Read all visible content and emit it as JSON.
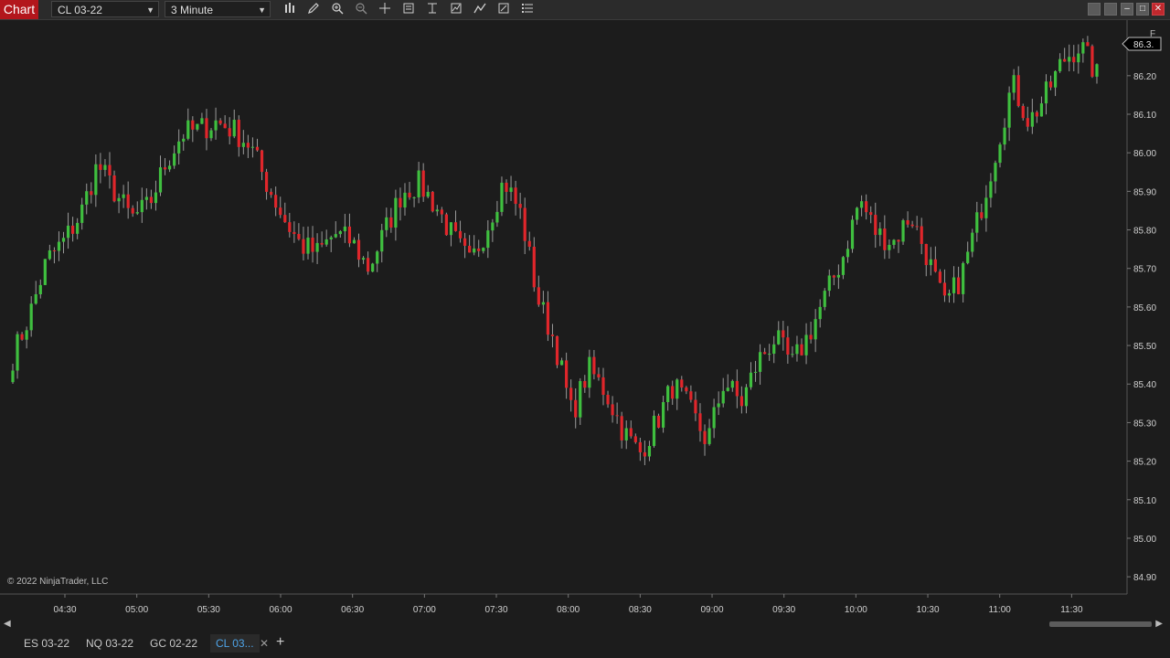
{
  "toolbar": {
    "chart_label": "Chart",
    "instrument": "CL 03-22",
    "interval": "3 Minute",
    "corner_label": "F"
  },
  "footer": {
    "copyright": "© 2022 NinjaTrader, LLC"
  },
  "tabs": [
    {
      "label": "ES 03-22"
    },
    {
      "label": "NQ 03-22"
    },
    {
      "label": "GC 02-22"
    },
    {
      "label": "CL 03..."
    }
  ],
  "colors": {
    "up": "#3fbf3f",
    "down": "#e0262b",
    "background": "#1c1c1c",
    "accent": "#b3161c"
  },
  "chart_data": {
    "type": "candlestick",
    "x_tick_labels": [
      "04:30",
      "05:00",
      "05:30",
      "06:00",
      "06:30",
      "07:00",
      "07:30",
      "08:00",
      "08:30",
      "09:00",
      "09:30",
      "10:00",
      "10:30",
      "11:00",
      "11:30"
    ],
    "y_tick_labels": [
      "86.20",
      "86.10",
      "86.00",
      "85.90",
      "85.80",
      "85.70",
      "85.60",
      "85.50",
      "85.40",
      "85.30",
      "85.20",
      "85.10",
      "85.00",
      "84.90"
    ],
    "y_tick_values": [
      86.2,
      86.1,
      86.0,
      85.9,
      85.8,
      85.7,
      85.6,
      85.5,
      85.4,
      85.3,
      85.2,
      85.1,
      85.0,
      84.9
    ],
    "ylim": [
      84.86,
      86.33
    ],
    "current_price_label": "86.3.",
    "close_path": [
      85.47,
      85.58,
      85.72,
      85.77,
      85.84,
      85.97,
      85.9,
      85.83,
      85.86,
      85.97,
      86.05,
      86.06,
      86.08,
      86.06,
      86.02,
      85.92,
      85.83,
      85.76,
      85.74,
      85.79,
      85.77,
      85.7,
      85.8,
      85.9,
      85.92,
      85.86,
      85.78,
      85.71,
      85.81,
      85.93,
      85.84,
      85.62,
      85.51,
      85.32,
      85.44,
      85.38,
      85.28,
      85.22,
      85.3,
      85.4,
      85.33,
      85.25,
      85.41,
      85.35,
      85.46,
      85.52,
      85.45,
      85.53,
      85.63,
      85.73,
      85.88,
      85.79,
      85.77,
      85.84,
      85.73,
      85.6,
      85.68,
      85.83,
      86.0,
      86.18,
      86.08,
      86.15,
      86.24,
      86.28,
      86.2
    ]
  }
}
